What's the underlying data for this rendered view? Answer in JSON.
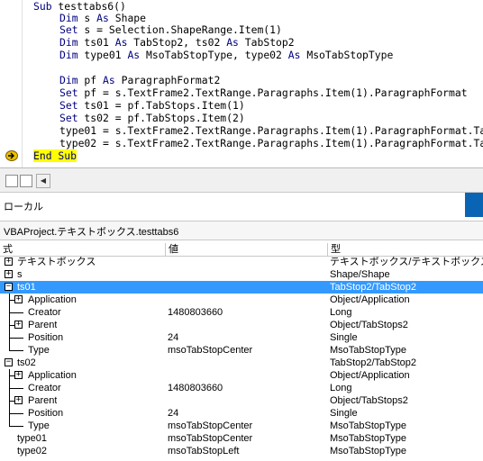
{
  "code": {
    "lines": [
      [
        "Sub testtabs6()"
      ],
      [
        "Dim s As Shape"
      ],
      [
        "Set s = Selection.ShapeRange.Item(1)"
      ],
      [
        "Dim ts01 As TabStop2, ts02 As TabStop2"
      ],
      [
        "Dim type01 As MsoTabStopType, type02 As MsoTabStopType"
      ],
      [
        ""
      ],
      [
        "Dim pf As ParagraphFormat2"
      ],
      [
        "Set pf = s.TextFrame2.TextRange.Paragraphs.Item(1).ParagraphFormat"
      ],
      [
        "Set ts01 = pf.TabStops.Item(1)"
      ],
      [
        "Set ts02 = pf.TabStops.Item(2)"
      ],
      [
        "type01 = s.TextFrame2.TextRange.Paragraphs.Item(1).ParagraphFormat.Ta"
      ],
      [
        "type02 = s.TextFrame2.TextRange.Paragraphs.Item(1).ParagraphFormat.Ta"
      ],
      [
        "End Sub"
      ]
    ]
  },
  "locals": {
    "title": "ローカル",
    "context": "VBAProject.テキストボックス.testtabs6",
    "headers": {
      "expression": "式",
      "value": "値",
      "type": "型"
    },
    "rows": [
      {
        "expr": "テキストボックス",
        "value": "",
        "type": "テキストボックス/テキストボックス"
      },
      {
        "expr": "s",
        "value": "",
        "type": "Shape/Shape"
      },
      {
        "expr": "ts01",
        "value": "",
        "type": "TabStop2/TabStop2"
      },
      {
        "expr": "Application",
        "value": "",
        "type": "Object/Application"
      },
      {
        "expr": "Creator",
        "value": "1480803660",
        "type": "Long"
      },
      {
        "expr": "Parent",
        "value": "",
        "type": "Object/TabStops2"
      },
      {
        "expr": "Position",
        "value": "24",
        "type": "Single"
      },
      {
        "expr": "Type",
        "value": "msoTabStopCenter",
        "type": "MsoTabStopType"
      },
      {
        "expr": "ts02",
        "value": "",
        "type": "TabStop2/TabStop2"
      },
      {
        "expr": "Application",
        "value": "",
        "type": "Object/Application"
      },
      {
        "expr": "Creator",
        "value": "1480803660",
        "type": "Long"
      },
      {
        "expr": "Parent",
        "value": "",
        "type": "Object/TabStops2"
      },
      {
        "expr": "Position",
        "value": "24",
        "type": "Single"
      },
      {
        "expr": "Type",
        "value": "msoTabStopCenter",
        "type": "MsoTabStopType"
      },
      {
        "expr": "type01",
        "value": "msoTabStopCenter",
        "type": "MsoTabStopType"
      },
      {
        "expr": "type02",
        "value": "msoTabStopLeft",
        "type": "MsoTabStopType"
      }
    ]
  },
  "colors": {
    "keyword": "#00007f",
    "highlight": "#ffff00",
    "selection": "#3399ff",
    "accent": "#0a64b4"
  }
}
